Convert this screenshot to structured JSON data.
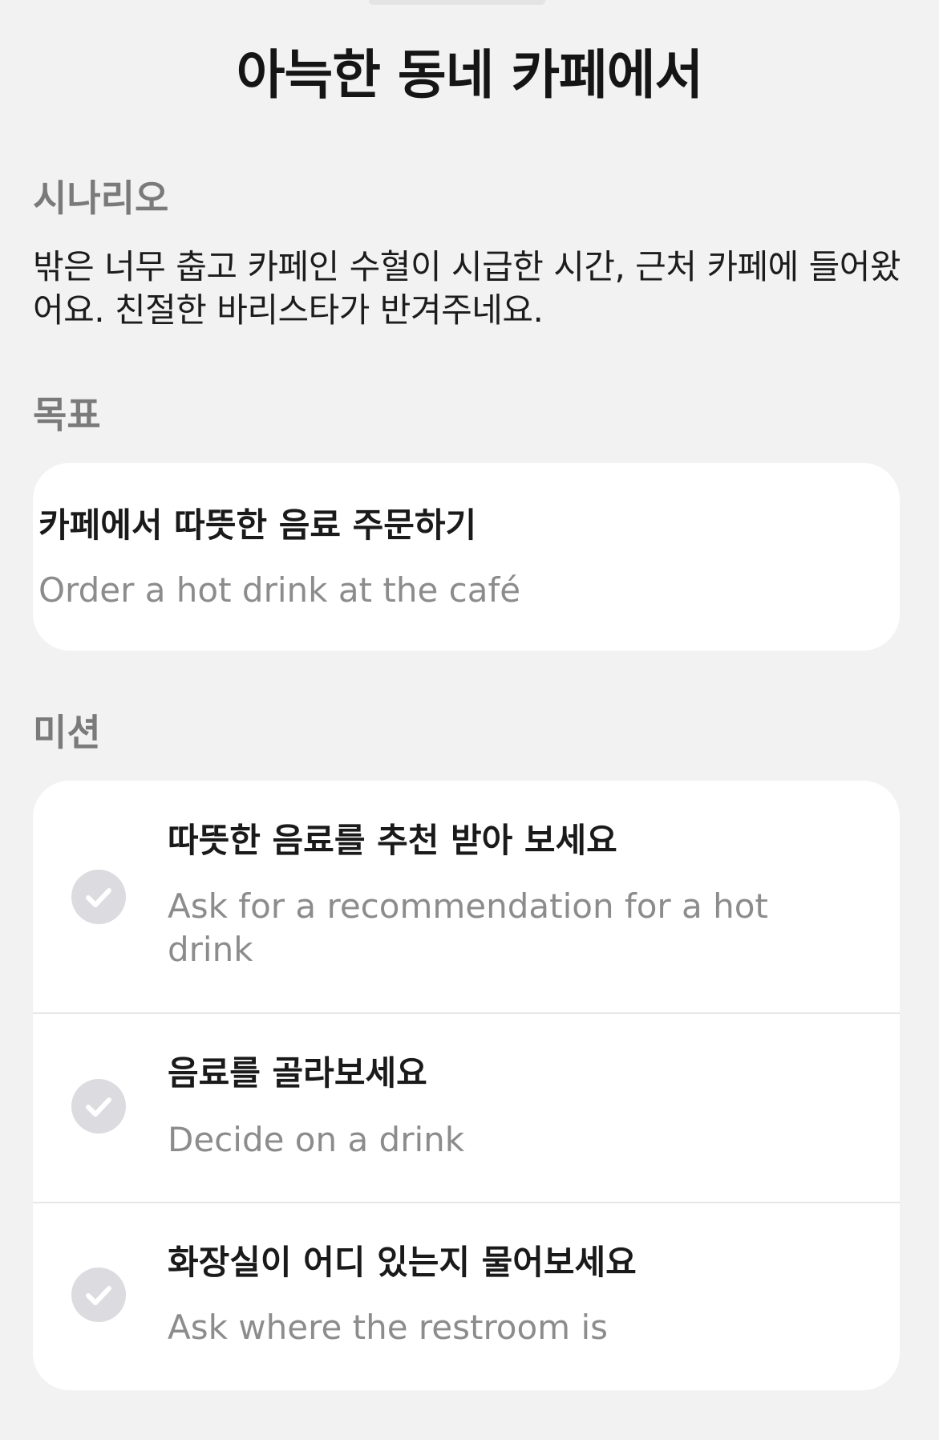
{
  "title": "아늑한 동네 카페에서",
  "scenario": {
    "label": "시나리오",
    "text": "밖은 너무 춥고 카페인 수혈이 시급한 시간, 근처 카페에 들어왔어요. 친절한 바리스타가 반겨주네요."
  },
  "goal": {
    "label": "목표",
    "ko": "카페에서 따뜻한 음료 주문하기",
    "en": "Order a hot drink at the café"
  },
  "missions": {
    "label": "미션",
    "items": [
      {
        "ko": "따뜻한 음료를 추천 받아 보세요",
        "en": "Ask for a recommendation for a hot drink",
        "icon": "checkmark-circle-icon",
        "completed": false
      },
      {
        "ko": "음료를 골라보세요",
        "en": "Decide on a drink",
        "icon": "checkmark-circle-icon",
        "completed": false
      },
      {
        "ko": "화장실이 어디 있는지 물어보세요",
        "en": "Ask where the restroom is",
        "icon": "checkmark-circle-icon",
        "completed": false
      }
    ]
  },
  "colors": {
    "background": "#f2f2f2",
    "card": "#ffffff",
    "section_label": "#7a7a7a",
    "secondary_text": "#8c8c8c",
    "check_inactive": "#dcdce0"
  }
}
